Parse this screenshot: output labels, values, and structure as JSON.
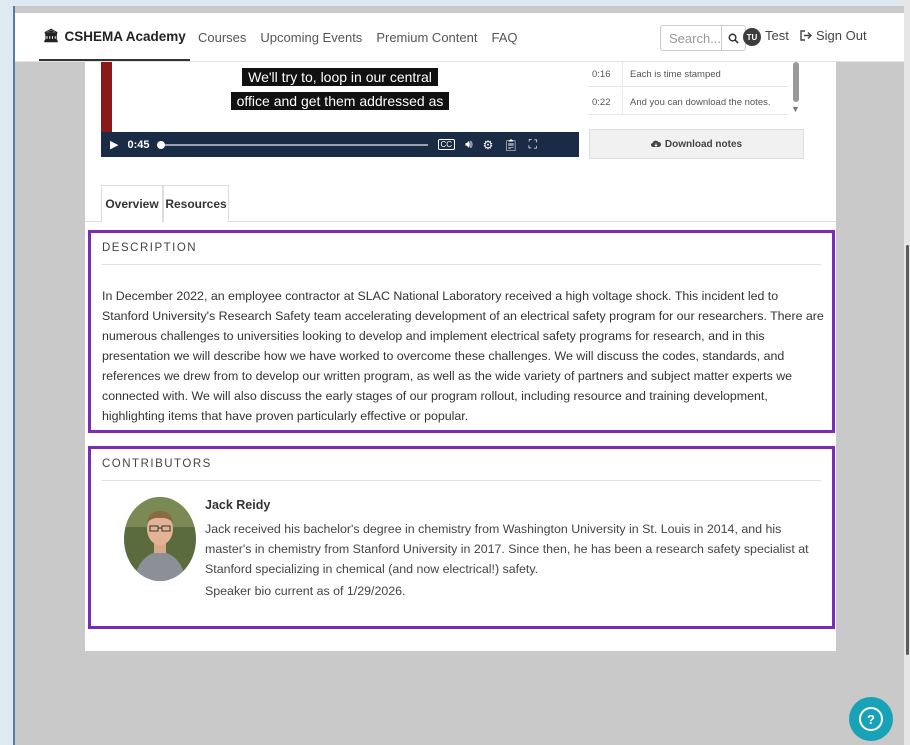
{
  "nav": {
    "brand": "CSHEMA Academy",
    "links": [
      "Courses",
      "Upcoming Events",
      "Premium Content",
      "FAQ"
    ],
    "search_placeholder": "Search...",
    "user_initials": "TU",
    "user_name": "Test",
    "sign_out": "Sign Out"
  },
  "video": {
    "caption_line1": "We'll try to, loop in our central",
    "caption_line2": "office and get them addressed as",
    "current_time": "0:45",
    "progress": 0.0
  },
  "transcript": {
    "rows": [
      {
        "time": "0:16",
        "text": "Each is time stamped"
      },
      {
        "time": "0:22",
        "text": "And you can download the notes."
      }
    ],
    "download_label": "Download notes"
  },
  "tabs": [
    "Overview",
    "Resources"
  ],
  "description": {
    "title": "DESCRIPTION",
    "text": "In December 2022, an employee contractor at SLAC National Laboratory received a high voltage shock. This incident led to Stanford University's Research Safety team accelerating development of an electrical safety program for our researchers. There are numerous challenges to universities looking to develop and implement electrical safety programs for research, and in this presentation we will describe how we have worked to overcome these challenges. We will discuss the codes, standards, and references we drew from to develop our written program, as well as the wide variety of partners and subject matter experts we connected with. We will also discuss the early stages of our program rollout, including resource and training development, highlighting items that have proven particularly effective or popular."
  },
  "contributors": {
    "title": "CONTRIBUTORS",
    "items": [
      {
        "name": "Jack Reidy",
        "bio": "Jack received his bachelor's degree in chemistry from Washington University in St. Louis in 2014, and his master's in chemistry from Stanford University in 2017. Since then, he has been a research safety specialist at Stanford specializing in chemical (and now electrical!) safety.",
        "note": "Speaker bio current as of 1/29/2026."
      }
    ]
  },
  "colors": {
    "highlight": "#7b2cb4",
    "help_fab": "#17a2b8",
    "video_controls": "#1a2b45"
  }
}
